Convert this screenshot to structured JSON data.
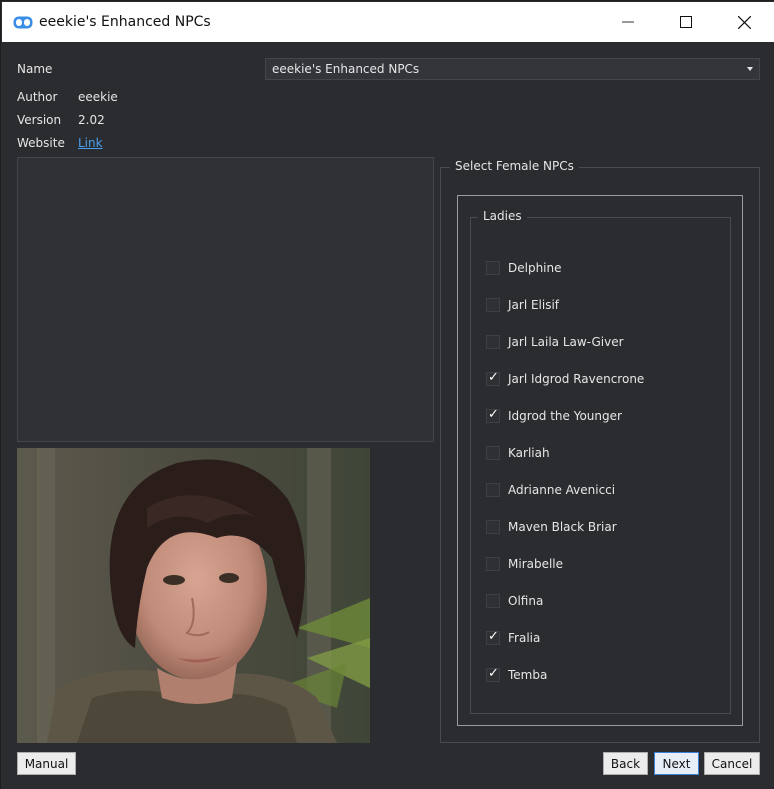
{
  "window": {
    "title": "eeekie's Enhanced NPCs"
  },
  "info": {
    "name_label": "Name",
    "name_value": "eeekie's Enhanced NPCs",
    "author_label": "Author",
    "author_value": "eeekie",
    "version_label": "Version",
    "version_value": "2.02",
    "website_label": "Website",
    "website_link": "Link"
  },
  "selection": {
    "group_title": "Select Female NPCs",
    "subgroup_title": "Ladies",
    "items": [
      {
        "label": "Delphine",
        "checked": false
      },
      {
        "label": "Jarl Elisif",
        "checked": false
      },
      {
        "label": "Jarl Laila Law-Giver",
        "checked": false
      },
      {
        "label": "Jarl Idgrod Ravencrone",
        "checked": true
      },
      {
        "label": "Idgrod the Younger",
        "checked": true
      },
      {
        "label": "Karliah",
        "checked": false
      },
      {
        "label": "Adrianne Avenicci",
        "checked": false
      },
      {
        "label": "Maven Black Briar",
        "checked": false
      },
      {
        "label": "Mirabelle",
        "checked": false
      },
      {
        "label": "Olfina",
        "checked": false
      },
      {
        "label": "Fralia",
        "checked": true
      },
      {
        "label": "Temba",
        "checked": true
      }
    ]
  },
  "buttons": {
    "manual": "Manual",
    "back": "Back",
    "next": "Next",
    "cancel": "Cancel"
  },
  "colors": {
    "background": "#2b2c30",
    "link": "#4aa0f0",
    "app_icon": "#3a8ee6"
  },
  "icons": {
    "app": "app-logo-icon",
    "minimize": "minimize-icon",
    "maximize": "maximize-icon",
    "close": "close-icon",
    "dropdown": "chevron-down-icon",
    "check": "checkmark-icon"
  }
}
